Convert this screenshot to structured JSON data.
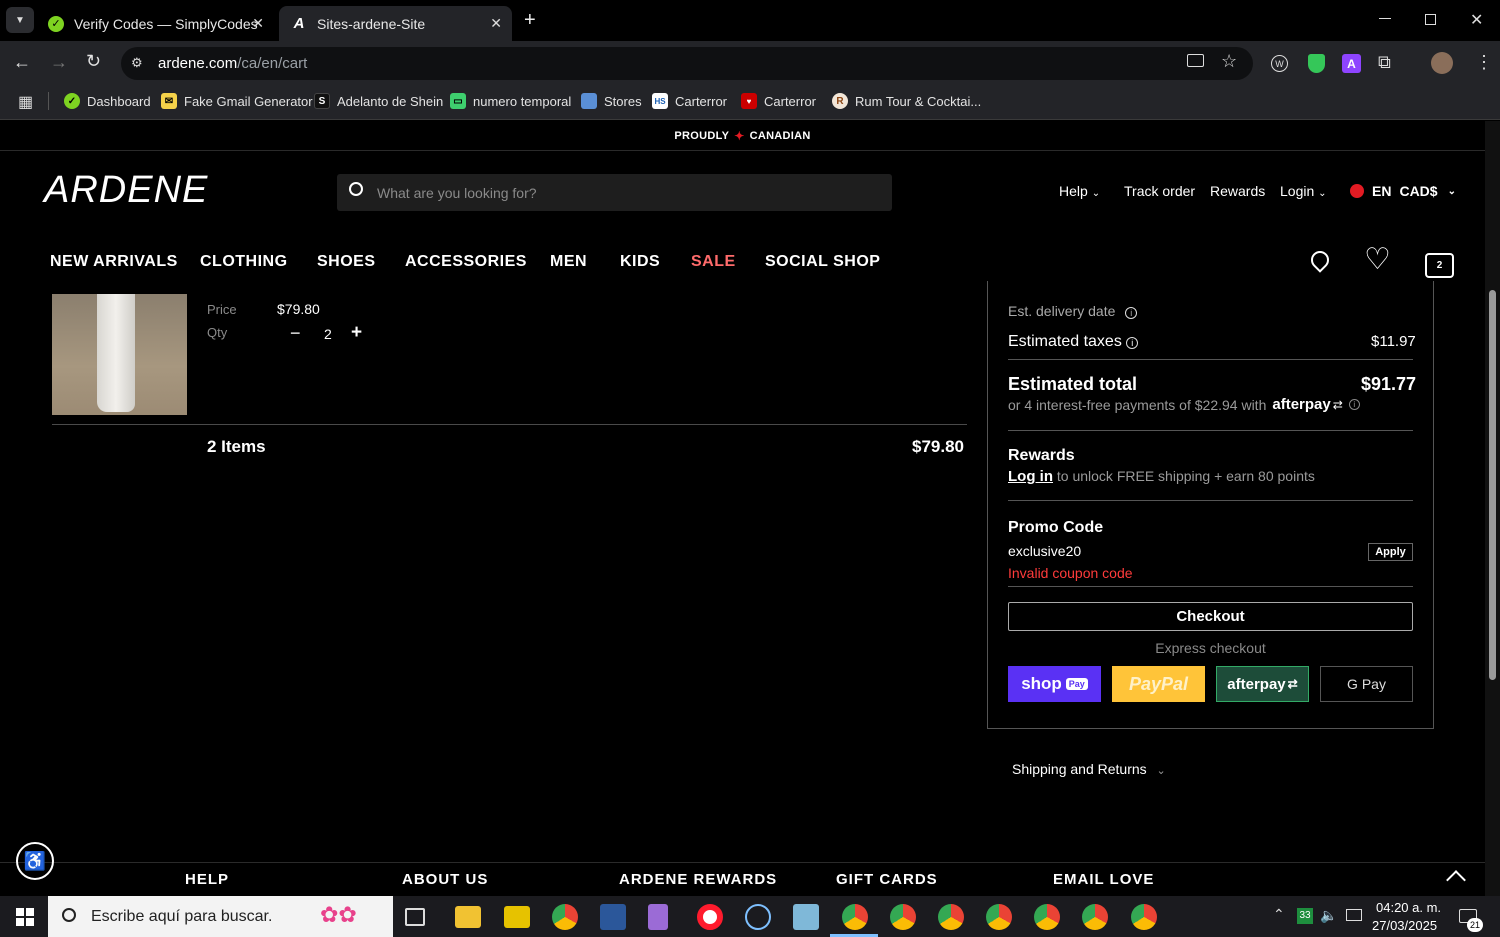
{
  "browser": {
    "tabs": [
      {
        "title": "Verify Codes — SimplyCodes",
        "active": false
      },
      {
        "title": "Sites-ardene-Site",
        "active": true
      }
    ],
    "url_domain": "ardene.com",
    "url_path": "/ca/en/cart",
    "bookmarks": [
      "Dashboard",
      "Fake Gmail Generator",
      "Adelanto de Shein",
      "numero temporal",
      "Stores",
      "Carterror",
      "Carterror",
      "Rum Tour & Cocktai..."
    ]
  },
  "site": {
    "banner_left": "PROUDLY",
    "banner_right": "CANADIAN",
    "logo": "ARDENE",
    "search_placeholder": "What are you looking for?",
    "utility": {
      "help": "Help",
      "track": "Track order",
      "rewards": "Rewards",
      "login": "Login",
      "lang": "EN",
      "currency": "CAD$"
    },
    "nav": [
      "NEW ARRIVALS",
      "CLOTHING",
      "SHOES",
      "ACCESSORIES",
      "MEN",
      "KIDS",
      "SALE",
      "SOCIAL SHOP"
    ],
    "cart_count": "2",
    "accent_sale": "#ff6b6b"
  },
  "cart": {
    "price_label": "Price",
    "price": "$79.80",
    "qty_label": "Qty",
    "qty": "2",
    "items_label": "2 Items",
    "items_total": "$79.80"
  },
  "summary": {
    "est_delivery": "Est. delivery date",
    "taxes_label": "Estimated taxes",
    "taxes": "$11.97",
    "total_label": "Estimated total",
    "total": "$91.77",
    "afterpay_text": "or 4 interest-free payments of $22.94 with",
    "afterpay_brand": "afterpay",
    "rewards_title": "Rewards",
    "rewards_login": "Log in",
    "rewards_text": "to unlock FREE shipping + earn 80 points",
    "promo_title": "Promo Code",
    "promo_value": "exclusive20",
    "apply": "Apply",
    "promo_error": "Invalid coupon code",
    "error_color": "#ff3b3b",
    "checkout": "Checkout",
    "express": "Express checkout",
    "pay_shop": "shop",
    "pay_shop_badge": "Pay",
    "pay_paypal": "PayPal",
    "pay_afterpay": "afterpay",
    "pay_gpay": "G Pay",
    "shipping_returns": "Shipping and Returns"
  },
  "footer": [
    "HELP",
    "ABOUT US",
    "ARDENE REWARDS",
    "GIFT CARDS",
    "EMAIL LOVE"
  ],
  "taskbar": {
    "search_placeholder": "Escribe aquí para buscar.",
    "time": "04:20 a. m.",
    "date": "27/03/2025",
    "notifications": "21",
    "tray_num": "33"
  }
}
